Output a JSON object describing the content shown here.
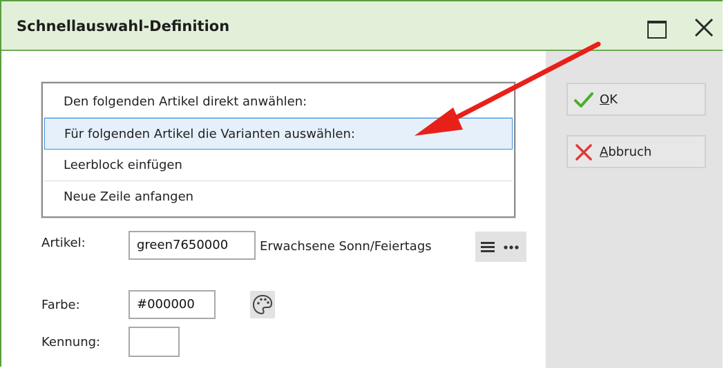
{
  "window": {
    "title": "Schnellauswahl-Definition",
    "accent": "#5a9e3e",
    "titlebar_bg": "#e2f0d9",
    "icons": {
      "maximize": "maximize-icon",
      "close": "close-icon"
    }
  },
  "list": {
    "items": [
      {
        "label": "Den folgenden Artikel direkt anwählen:",
        "selected": false
      },
      {
        "label": "Für folgenden Artikel die Varianten auswählen:",
        "selected": true
      },
      {
        "label": "Leerblock einfügen",
        "selected": false
      },
      {
        "label": "Neue Zeile anfangen",
        "selected": false
      }
    ]
  },
  "form": {
    "artikel_label": "Artikel:",
    "artikel_value": "green7650000",
    "artikel_desc": "Erwachsene Sonn/Feiertags",
    "farbe_label": "Farbe:",
    "farbe_value": "#000000",
    "kennung_label": "Kennung:",
    "kennung_value": ""
  },
  "buttons": {
    "ok_mnemonic": "O",
    "ok_rest": "K",
    "cancel_mnemonic": "A",
    "cancel_rest": "bbruch",
    "ok_icon": "checkmark-icon",
    "cancel_icon": "x-icon",
    "ok_color": "#4caf2c",
    "cancel_color": "#e03a3a"
  },
  "annotation": {
    "arrow_color": "#e8201a"
  }
}
